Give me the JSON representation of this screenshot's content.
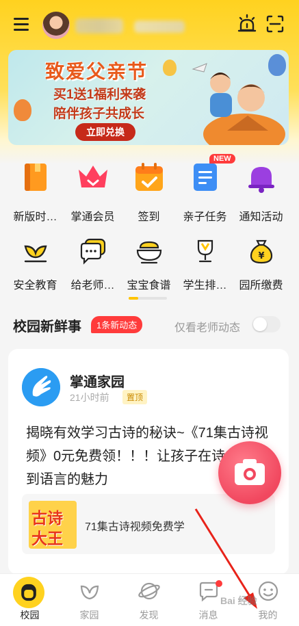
{
  "topbar": {
    "icons": [
      "menu-icon",
      "alarm-icon",
      "scan-icon"
    ]
  },
  "banner": {
    "title": "致爱父亲节",
    "line1": "买1送1福利来袭",
    "line2": "陪伴孩子共成长",
    "button": "立即兑换"
  },
  "grid": {
    "new_badge": "NEW",
    "items": [
      {
        "label": "新版时…",
        "icon": "book-icon"
      },
      {
        "label": "掌通会员",
        "icon": "crown-icon"
      },
      {
        "label": "签到",
        "icon": "calendar-check-icon"
      },
      {
        "label": "亲子任务",
        "icon": "document-icon"
      },
      {
        "label": "通知活动",
        "icon": "bell-icon"
      },
      {
        "label": "安全教育",
        "icon": "sprout-icon"
      },
      {
        "label": "给老师…",
        "icon": "chat-icon"
      },
      {
        "label": "宝宝食谱",
        "icon": "bowl-icon"
      },
      {
        "label": "学生排…",
        "icon": "trophy-icon"
      },
      {
        "label": "园所缴费",
        "icon": "money-bag-icon"
      }
    ]
  },
  "news": {
    "title": "校园新鲜事",
    "badge": "1条新动态",
    "filter_label": "仅看老师动态"
  },
  "card": {
    "name": "掌通家园",
    "time": "21小时前",
    "pin": "置顶",
    "text": "揭晓有效学习古诗的秘诀~《71集古诗视频》0元免费领！！！让孩子在诗中感受到语言的魅力",
    "link_thumb_line1": "古诗",
    "link_thumb_line2": "大王",
    "link_text": "71集古诗视频免费学"
  },
  "tabs": [
    {
      "label": "校园",
      "icon": "school-icon",
      "active": true
    },
    {
      "label": "家园",
      "icon": "leaf-icon"
    },
    {
      "label": "发现",
      "icon": "planet-icon"
    },
    {
      "label": "消息",
      "icon": "message-icon"
    },
    {
      "label": "我的",
      "icon": "profile-icon"
    }
  ],
  "watermark": "Bai 经验",
  "colors": {
    "brand_yellow": "#ffd21f",
    "badge_red": "#ff3b3b",
    "camera_pink": "#f1485f"
  }
}
